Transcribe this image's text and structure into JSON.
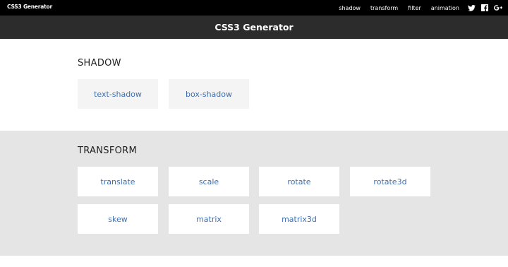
{
  "topbar": {
    "brand": "CSS3 Generator",
    "nav": [
      "shadow",
      "transform",
      "filter",
      "animation"
    ],
    "icons": [
      "twitter-icon",
      "facebook-icon",
      "google-plus-icon"
    ]
  },
  "hero": {
    "title": "CSS3 Generator"
  },
  "sections": {
    "shadow": {
      "title": "SHADOW",
      "items": [
        "text-shadow",
        "box-shadow"
      ]
    },
    "transform": {
      "title": "TRANSFORM",
      "items": [
        "translate",
        "scale",
        "rotate",
        "rotate3d",
        "skew",
        "matrix",
        "matrix3d"
      ]
    }
  },
  "colors": {
    "topbar_bg": "#000000",
    "hero_bg": "#2c2c2c",
    "transform_bg": "#e5e5e5",
    "link": "#3d6fb0"
  }
}
